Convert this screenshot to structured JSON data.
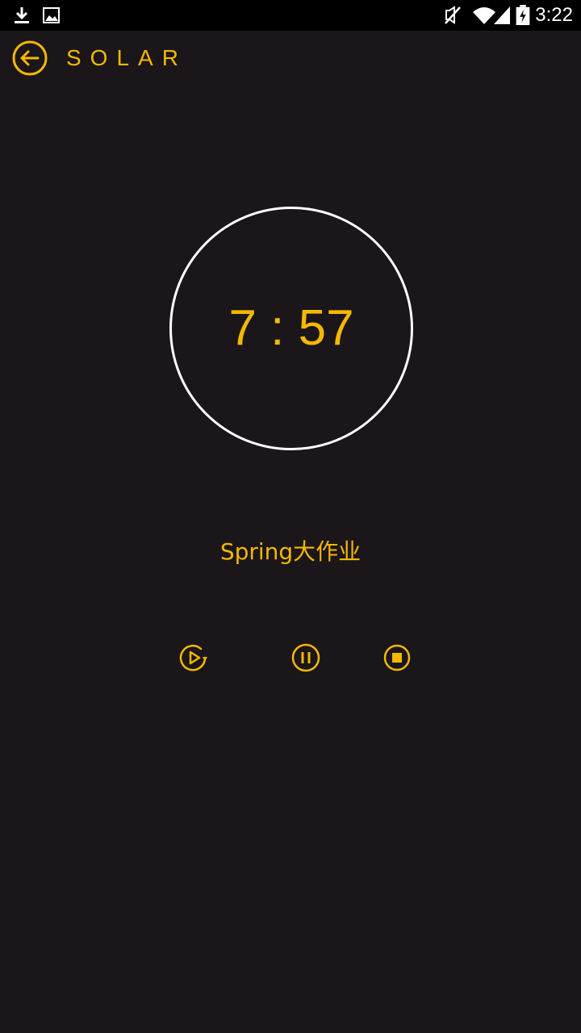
{
  "colors": {
    "accent": "#f5b800",
    "background": "#1a1619",
    "ring": "#ffffff",
    "status_bar": "#000000"
  },
  "status_bar": {
    "time": "3:22",
    "icons": [
      "download-icon",
      "image-icon",
      "mute-icon",
      "wifi-icon",
      "signal-icon",
      "battery-charging-icon"
    ]
  },
  "header": {
    "title": "SOLAR",
    "back_icon": "arrow-left-circle-icon"
  },
  "timer": {
    "display": "7 : 57"
  },
  "task": {
    "name": "Spring大作业"
  },
  "controls": [
    {
      "name": "restart-button",
      "icon": "play-restart-icon"
    },
    {
      "name": "pause-button",
      "icon": "pause-circle-icon"
    },
    {
      "name": "stop-button",
      "icon": "stop-circle-icon"
    }
  ]
}
